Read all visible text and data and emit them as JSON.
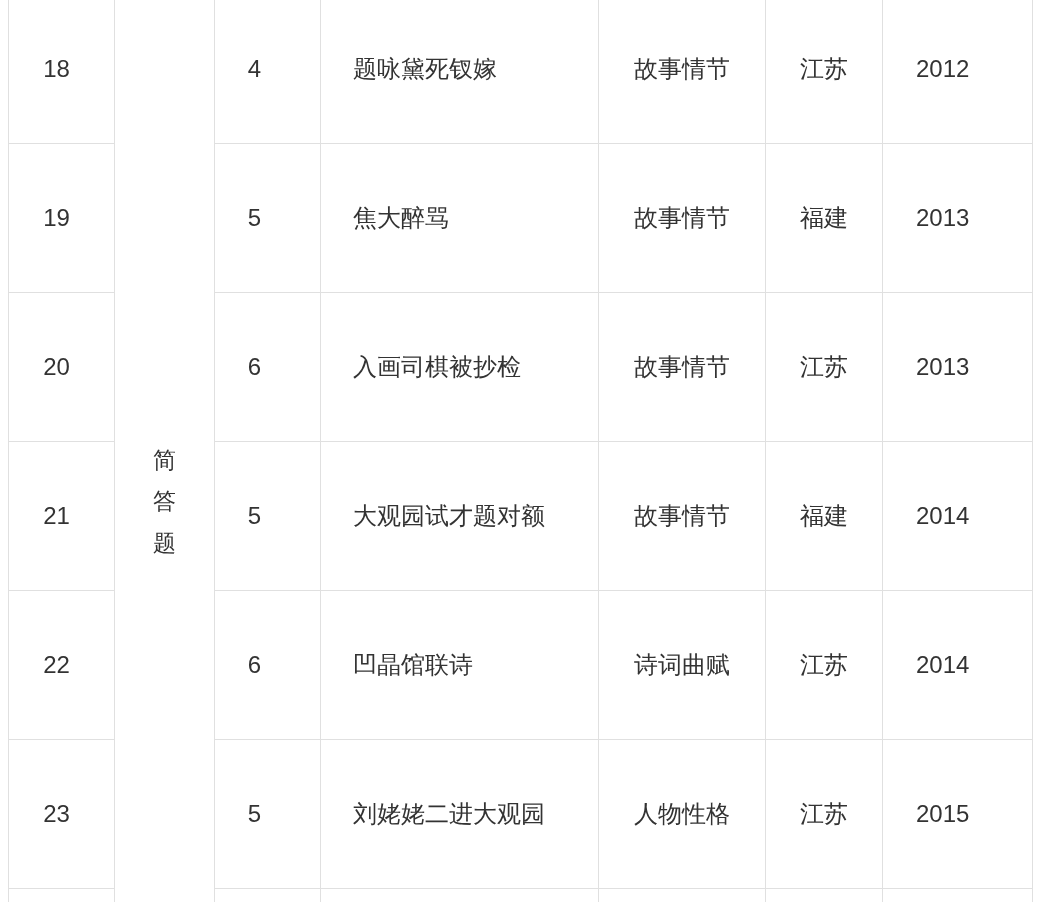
{
  "table": {
    "group_label": "简答题",
    "rows": [
      {
        "number": "18",
        "score": "4",
        "title": "题咏黛死钗嫁",
        "category": "故事情节",
        "province": "江苏",
        "year": "2012"
      },
      {
        "number": "19",
        "score": "5",
        "title": "焦大醉骂",
        "category": "故事情节",
        "province": "福建",
        "year": "2013"
      },
      {
        "number": "20",
        "score": "6",
        "title": "入画司棋被抄检",
        "category": "故事情节",
        "province": "江苏",
        "year": "2013"
      },
      {
        "number": "21",
        "score": "5",
        "title": "大观园试才题对额",
        "category": "故事情节",
        "province": "福建",
        "year": "2014"
      },
      {
        "number": "22",
        "score": "6",
        "title": "凹晶馆联诗",
        "category": "诗词曲赋",
        "province": "江苏",
        "year": "2014"
      },
      {
        "number": "23",
        "score": "5",
        "title": "刘姥姥二进大观园",
        "category": "人物性格",
        "province": "江苏",
        "year": "2015"
      }
    ]
  }
}
